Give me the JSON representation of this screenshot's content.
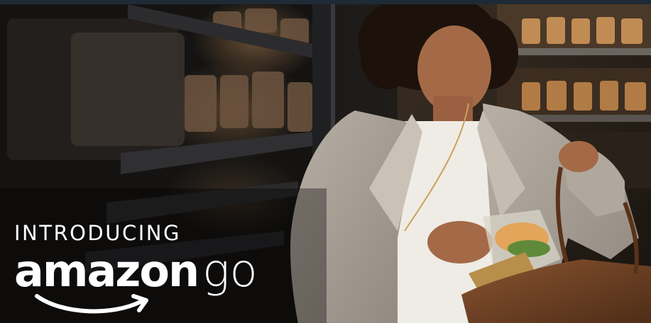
{
  "hero": {
    "intro_text": "INTRODUCING",
    "brand_word": "amazon",
    "brand_suffix": "go"
  },
  "colors": {
    "background": "#111111",
    "top_bar": "#1e2b36",
    "logo_text": "#ffffff"
  },
  "icons": {
    "logo_smile": "amazon-smile-icon"
  }
}
